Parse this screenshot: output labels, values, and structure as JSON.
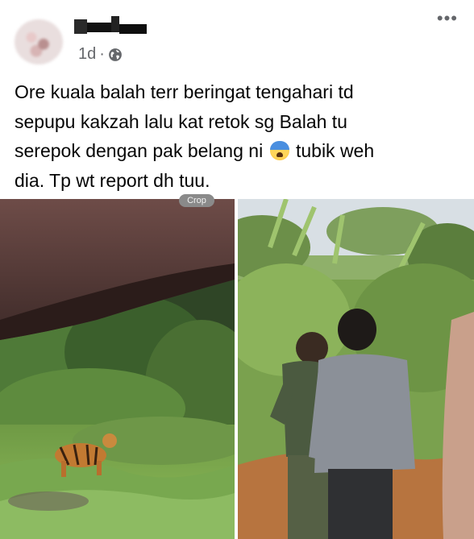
{
  "post": {
    "time": "1d",
    "separator": "·",
    "text_line1": "Ore kuala balah terr beringat tengahari td",
    "text_line2": "sepupu kakzah lalu kat retok sg Balah tu",
    "text_line3a": "serepok dengan pak belang ni ",
    "text_line3b": " tubik weh",
    "text_line4": "dia. Tp wt report dh tuu.",
    "emoji": "anxious-face-with-sweat",
    "more_icon": "more-horizontal-icon",
    "privacy_icon": "globe-icon"
  },
  "photos": {
    "crop_label": "Crop",
    "left": "tiger-on-roadside-photo",
    "right": "two-men-at-roadside-photo"
  },
  "colors": {
    "meta_text": "#65676b",
    "body_text": "#050505"
  }
}
